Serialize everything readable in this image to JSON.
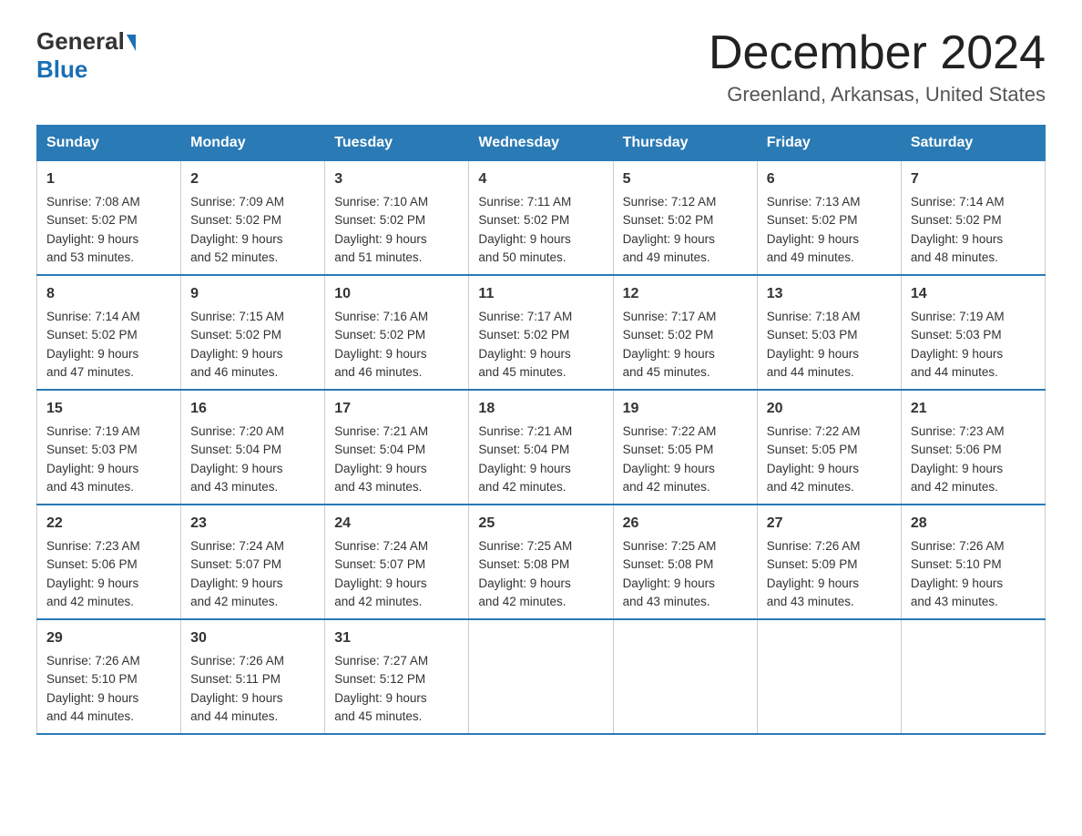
{
  "header": {
    "logo_general": "General",
    "logo_blue": "Blue",
    "month_title": "December 2024",
    "location": "Greenland, Arkansas, United States"
  },
  "weekdays": [
    "Sunday",
    "Monday",
    "Tuesday",
    "Wednesday",
    "Thursday",
    "Friday",
    "Saturday"
  ],
  "weeks": [
    [
      {
        "day": "1",
        "sunrise": "7:08 AM",
        "sunset": "5:02 PM",
        "daylight": "9 hours and 53 minutes."
      },
      {
        "day": "2",
        "sunrise": "7:09 AM",
        "sunset": "5:02 PM",
        "daylight": "9 hours and 52 minutes."
      },
      {
        "day": "3",
        "sunrise": "7:10 AM",
        "sunset": "5:02 PM",
        "daylight": "9 hours and 51 minutes."
      },
      {
        "day": "4",
        "sunrise": "7:11 AM",
        "sunset": "5:02 PM",
        "daylight": "9 hours and 50 minutes."
      },
      {
        "day": "5",
        "sunrise": "7:12 AM",
        "sunset": "5:02 PM",
        "daylight": "9 hours and 49 minutes."
      },
      {
        "day": "6",
        "sunrise": "7:13 AM",
        "sunset": "5:02 PM",
        "daylight": "9 hours and 49 minutes."
      },
      {
        "day": "7",
        "sunrise": "7:14 AM",
        "sunset": "5:02 PM",
        "daylight": "9 hours and 48 minutes."
      }
    ],
    [
      {
        "day": "8",
        "sunrise": "7:14 AM",
        "sunset": "5:02 PM",
        "daylight": "9 hours and 47 minutes."
      },
      {
        "day": "9",
        "sunrise": "7:15 AM",
        "sunset": "5:02 PM",
        "daylight": "9 hours and 46 minutes."
      },
      {
        "day": "10",
        "sunrise": "7:16 AM",
        "sunset": "5:02 PM",
        "daylight": "9 hours and 46 minutes."
      },
      {
        "day": "11",
        "sunrise": "7:17 AM",
        "sunset": "5:02 PM",
        "daylight": "9 hours and 45 minutes."
      },
      {
        "day": "12",
        "sunrise": "7:17 AM",
        "sunset": "5:02 PM",
        "daylight": "9 hours and 45 minutes."
      },
      {
        "day": "13",
        "sunrise": "7:18 AM",
        "sunset": "5:03 PM",
        "daylight": "9 hours and 44 minutes."
      },
      {
        "day": "14",
        "sunrise": "7:19 AM",
        "sunset": "5:03 PM",
        "daylight": "9 hours and 44 minutes."
      }
    ],
    [
      {
        "day": "15",
        "sunrise": "7:19 AM",
        "sunset": "5:03 PM",
        "daylight": "9 hours and 43 minutes."
      },
      {
        "day": "16",
        "sunrise": "7:20 AM",
        "sunset": "5:04 PM",
        "daylight": "9 hours and 43 minutes."
      },
      {
        "day": "17",
        "sunrise": "7:21 AM",
        "sunset": "5:04 PM",
        "daylight": "9 hours and 43 minutes."
      },
      {
        "day": "18",
        "sunrise": "7:21 AM",
        "sunset": "5:04 PM",
        "daylight": "9 hours and 42 minutes."
      },
      {
        "day": "19",
        "sunrise": "7:22 AM",
        "sunset": "5:05 PM",
        "daylight": "9 hours and 42 minutes."
      },
      {
        "day": "20",
        "sunrise": "7:22 AM",
        "sunset": "5:05 PM",
        "daylight": "9 hours and 42 minutes."
      },
      {
        "day": "21",
        "sunrise": "7:23 AM",
        "sunset": "5:06 PM",
        "daylight": "9 hours and 42 minutes."
      }
    ],
    [
      {
        "day": "22",
        "sunrise": "7:23 AM",
        "sunset": "5:06 PM",
        "daylight": "9 hours and 42 minutes."
      },
      {
        "day": "23",
        "sunrise": "7:24 AM",
        "sunset": "5:07 PM",
        "daylight": "9 hours and 42 minutes."
      },
      {
        "day": "24",
        "sunrise": "7:24 AM",
        "sunset": "5:07 PM",
        "daylight": "9 hours and 42 minutes."
      },
      {
        "day": "25",
        "sunrise": "7:25 AM",
        "sunset": "5:08 PM",
        "daylight": "9 hours and 42 minutes."
      },
      {
        "day": "26",
        "sunrise": "7:25 AM",
        "sunset": "5:08 PM",
        "daylight": "9 hours and 43 minutes."
      },
      {
        "day": "27",
        "sunrise": "7:26 AM",
        "sunset": "5:09 PM",
        "daylight": "9 hours and 43 minutes."
      },
      {
        "day": "28",
        "sunrise": "7:26 AM",
        "sunset": "5:10 PM",
        "daylight": "9 hours and 43 minutes."
      }
    ],
    [
      {
        "day": "29",
        "sunrise": "7:26 AM",
        "sunset": "5:10 PM",
        "daylight": "9 hours and 44 minutes."
      },
      {
        "day": "30",
        "sunrise": "7:26 AM",
        "sunset": "5:11 PM",
        "daylight": "9 hours and 44 minutes."
      },
      {
        "day": "31",
        "sunrise": "7:27 AM",
        "sunset": "5:12 PM",
        "daylight": "9 hours and 45 minutes."
      },
      null,
      null,
      null,
      null
    ]
  ],
  "labels": {
    "sunrise": "Sunrise:",
    "sunset": "Sunset:",
    "daylight": "Daylight:"
  }
}
